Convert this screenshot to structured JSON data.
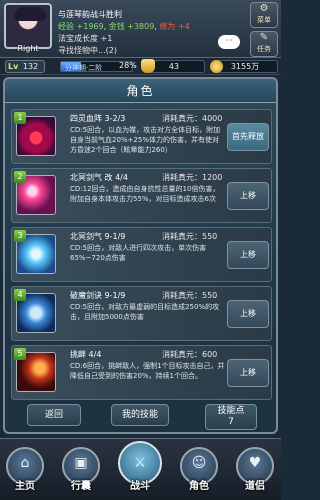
{
  "player": {
    "name": "Right",
    "level_tag": "Lv",
    "level": "132",
    "exp_bar_text": "分神期·二阶",
    "exp_percent": "28%",
    "exp_fraction": 0.28,
    "ingot": "43",
    "coins": "3155万"
  },
  "quest": {
    "title": "与莲琴韵战斗胜利",
    "reward_prefix": "经验",
    "reward_exp": "+1969",
    "reward_gold_label": "金钱",
    "reward_gold": "+3809",
    "reward_contrib_label": "修为",
    "reward_contrib": "+4",
    "line3": "法宝成长度 +1",
    "line4": "寻找怪物中...(2)"
  },
  "hud": {
    "chat_icon": "···",
    "menu_label": "菜单",
    "task_label": "任务"
  },
  "panel": {
    "title": "角色",
    "back_label": "返回",
    "my_skills_label": "我的技能",
    "points_label": "技能点",
    "points_value": "7"
  },
  "skills": [
    {
      "num": "1",
      "name": "四灵血阵 3-2/3",
      "cost": "消耗真元：4000",
      "desc": "CD:5回合，以血为媒，攻击对方全体目标，附加自身当前气血20%+25%体力的伤害，并有使对方昏迷2个回合（眩晕能力260）",
      "button": "首先释放",
      "icon": "blood-array-icon"
    },
    {
      "num": "2",
      "name": "北冥剑气 改 4/4",
      "cost": "消耗真元：1200",
      "desc": "CD:12回合，造成由自身抗性总量的10倍伤害，附加自身本体攻击力55%，对目标造成攻击6次",
      "button": "上移",
      "icon": "sword-qi-icon"
    },
    {
      "num": "3",
      "name": "北冥剑气 9-1/9",
      "cost": "消耗真元：550",
      "desc": "CD:5回合，对敌人进行四次攻击，单次伤害65%~720点伤害",
      "button": "上移",
      "icon": "ice-sword-icon"
    },
    {
      "num": "4",
      "name": "破魔剑诀 9-1/9",
      "cost": "消耗真元：550",
      "desc": "CD:5回合，对敌方最虚弱的目标造成250%的攻击，且附加5000点伤害",
      "button": "上移",
      "icon": "demon-break-icon"
    },
    {
      "num": "5",
      "name": "挑衅 4/4",
      "cost": "消耗真元：600",
      "desc": "CD:6回合，挑衅敌人，强制1个目标攻击自己，并降低自己受到的伤害20%，持续1个回合。",
      "button": "上移",
      "icon": "provoke-icon"
    }
  ],
  "nav": [
    {
      "label": "主页",
      "glyph": "⌂",
      "icon": "home-icon"
    },
    {
      "label": "行囊",
      "glyph": "▣",
      "icon": "bag-icon"
    },
    {
      "label": "战斗",
      "glyph": "⚔",
      "icon": "battle-icon"
    },
    {
      "label": "角色",
      "glyph": "☺",
      "icon": "character-icon"
    },
    {
      "label": "道侣",
      "glyph": "♥",
      "icon": "partner-icon"
    }
  ],
  "colors": {
    "accent": "#8ad04a",
    "panel": "#1e3646",
    "exp_fill": "#2a6ad0"
  }
}
